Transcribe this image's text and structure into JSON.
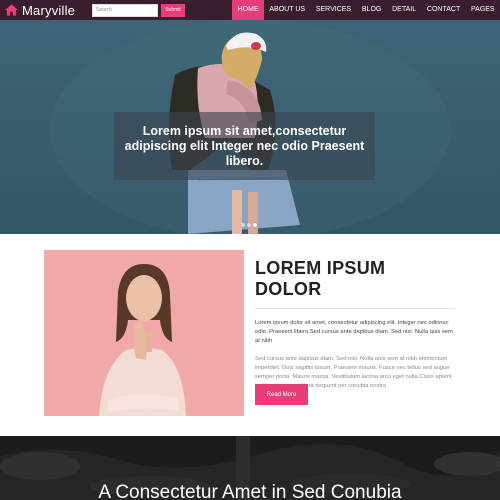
{
  "brand": {
    "name": "Maryville",
    "icon": "home-icon"
  },
  "search": {
    "placeholder": "Search",
    "submit_label": "Submit"
  },
  "nav": {
    "items": [
      {
        "label": "HOME",
        "active": true
      },
      {
        "label": "ABOUT US",
        "active": false
      },
      {
        "label": "SERVICES",
        "active": false
      },
      {
        "label": "BLOG",
        "active": false
      },
      {
        "label": "DETAIL",
        "active": false
      },
      {
        "label": "CONTACT",
        "active": false
      },
      {
        "label": "PAGES",
        "active": false
      }
    ]
  },
  "hero": {
    "caption": "Lorem ipsum sit amet,consectetur adipiscing elit Integer nec odio Praesent libero.",
    "slide_count": 3,
    "active_slide": 3
  },
  "about": {
    "title": "LOREM IPSUM DOLOR",
    "paragraph1": "Lorem ipsum dolor sit amet, consectetur adipiscing elit. Integer nec odionec odio. Praesent libero.Sed cursus ante dapibus diam. Sed nisi. Nulla quis sem at nibh",
    "paragraph2": "Sed cursus ante dapibus diam. Sed nisi. Nulla quis sem at nibh elementum imperdiet. Duis sagittis ipsum. Praesent mauris. Fusce nec tellus sed augue semper porta. Mauris massa. Vestibulum lacinia arcu eget nulla.Class aptent taciti sociosqu ad litora torquent per conubia nostra",
    "button_label": "Read More"
  },
  "banner": {
    "heading": "A Consectetur Amet in Sed Conubia"
  },
  "colors": {
    "accent": "#e63e7a",
    "navbar": "#3a1d2e",
    "hero_bg": "#3a5d6f",
    "photo_bg": "#f0a8a8",
    "dark_banner": "#262626"
  }
}
